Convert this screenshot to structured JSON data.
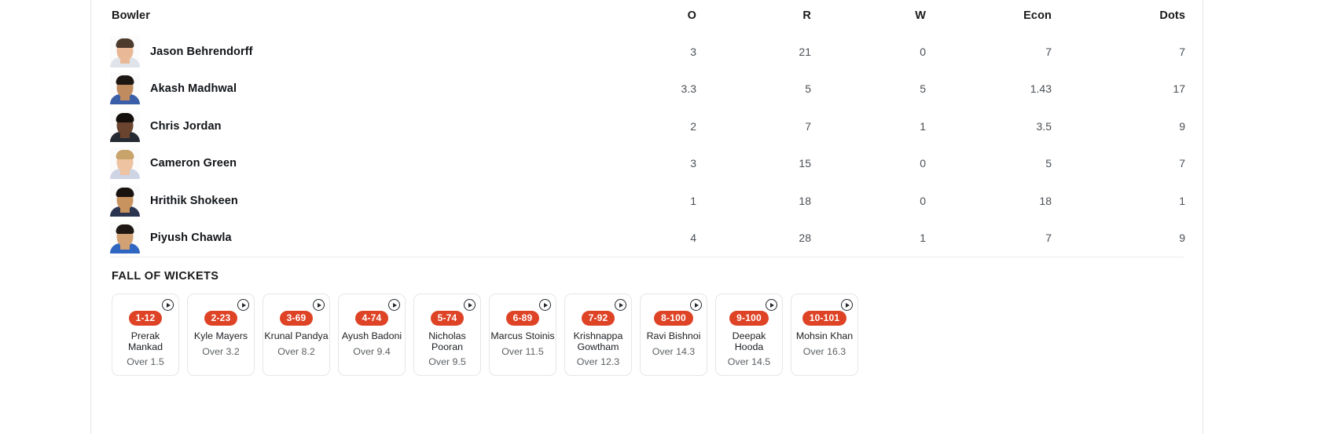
{
  "theme": {
    "accent": "#de4326",
    "text_primary": "#111418",
    "text_secondary": "#4a4f55",
    "border": "#e4e6e9"
  },
  "bowling": {
    "columns": [
      "Bowler",
      "O",
      "R",
      "W",
      "Econ",
      "Dots"
    ],
    "headers": {
      "bowler": "Bowler",
      "o": "O",
      "r": "R",
      "w": "W",
      "econ": "Econ",
      "dots": "Dots"
    },
    "rows": [
      {
        "name": "Jason Behrendorff",
        "o": "3",
        "r": "21",
        "w": "0",
        "econ": "7",
        "dots": "7",
        "avatar": {
          "skin": "#e9b896",
          "hair": "#4c3a2c",
          "shirt": "#dfe3ea"
        }
      },
      {
        "name": "Akash Madhwal",
        "o": "3.3",
        "r": "5",
        "w": "5",
        "econ": "1.43",
        "dots": "17",
        "avatar": {
          "skin": "#c08b5f",
          "hair": "#1d1713",
          "shirt": "#3b5ea8"
        }
      },
      {
        "name": "Chris Jordan",
        "o": "2",
        "r": "7",
        "w": "1",
        "econ": "3.5",
        "dots": "9",
        "avatar": {
          "skin": "#6b4430",
          "hair": "#140f0c",
          "shirt": "#262b33"
        }
      },
      {
        "name": "Cameron Green",
        "o": "3",
        "r": "15",
        "w": "0",
        "econ": "5",
        "dots": "7",
        "avatar": {
          "skin": "#edc3a1",
          "hair": "#c8a36a",
          "shirt": "#cfd4e4"
        }
      },
      {
        "name": "Hrithik Shokeen",
        "o": "1",
        "r": "18",
        "w": "0",
        "econ": "18",
        "dots": "1",
        "avatar": {
          "skin": "#c9935f",
          "hair": "#191310",
          "shirt": "#2b3550"
        }
      },
      {
        "name": "Piyush Chawla",
        "o": "4",
        "r": "28",
        "w": "1",
        "econ": "7",
        "dots": "9",
        "avatar": {
          "skin": "#d2a173",
          "hair": "#1e1713",
          "shirt": "#2f66c2"
        }
      }
    ]
  },
  "fall_of_wickets": {
    "title": "FALL OF WICKETS",
    "play_icon": "play-circle-icon",
    "items": [
      {
        "score": "1-12",
        "player": "Prerak Mankad",
        "over": "Over 1.5"
      },
      {
        "score": "2-23",
        "player": "Kyle Mayers",
        "over": "Over 3.2"
      },
      {
        "score": "3-69",
        "player": "Krunal Pandya",
        "over": "Over 8.2"
      },
      {
        "score": "4-74",
        "player": "Ayush Badoni",
        "over": "Over 9.4"
      },
      {
        "score": "5-74",
        "player": "Nicholas Pooran",
        "over": "Over 9.5"
      },
      {
        "score": "6-89",
        "player": "Marcus Stoinis",
        "over": "Over 11.5"
      },
      {
        "score": "7-92",
        "player": "Krishnappa Gowtham",
        "over": "Over 12.3"
      },
      {
        "score": "8-100",
        "player": "Ravi Bishnoi",
        "over": "Over 14.3"
      },
      {
        "score": "9-100",
        "player": "Deepak Hooda",
        "over": "Over 14.5"
      },
      {
        "score": "10-101",
        "player": "Mohsin Khan",
        "over": "Over 16.3"
      }
    ]
  }
}
